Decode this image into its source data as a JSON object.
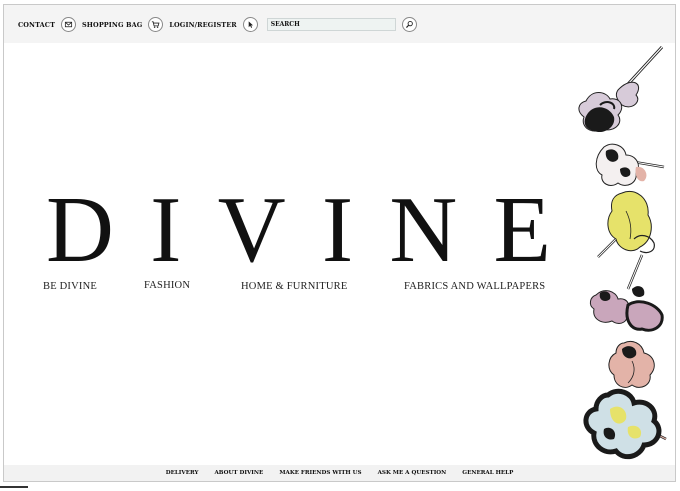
{
  "topnav": {
    "contact": "CONTACT",
    "shopping_bag": "SHOPPING BAG",
    "login": "LOGIN/REGISTER",
    "search_placeholder": "SEARCH"
  },
  "brand": {
    "letters": [
      "D",
      "I",
      "V",
      "I",
      "N",
      "E"
    ]
  },
  "categories": [
    "BE DIVINE",
    "FASHION",
    "HOME & FURNITURE",
    "FABRICS AND WALLPAPERS"
  ],
  "footer": [
    "DELIVERY",
    "ABOUT DIVINE",
    "MAKE FRIENDS WITH US",
    "ASK ME A QUESTION",
    "GENERAL HELP"
  ],
  "icons": {
    "contact": "envelope-icon",
    "bag": "shopping-cart-icon",
    "login": "cursor-pointer-icon",
    "search": "magnifier-icon"
  },
  "colors": {
    "topbar": "#f4f4f4",
    "search_field": "#eef3f2",
    "footer": "#f2f2f2",
    "flower_pink": "#c9a6bb",
    "flower_yellow": "#e6e26a",
    "flower_lilac": "#d7cbd9",
    "flower_salmon": "#e3b3a8",
    "flower_blue": "#cfe0e6"
  }
}
